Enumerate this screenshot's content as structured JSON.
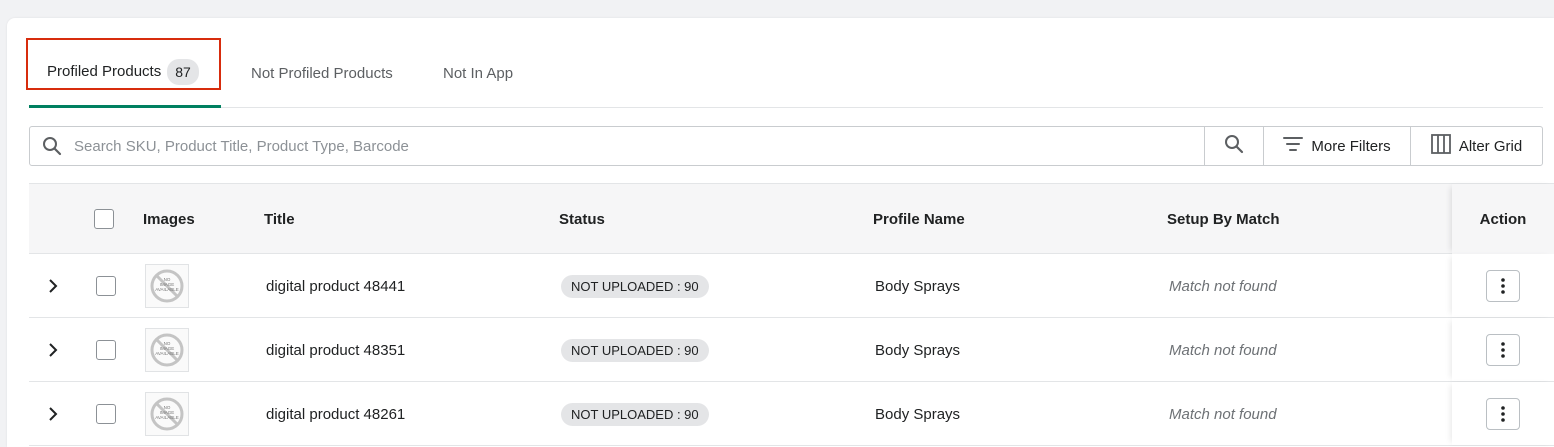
{
  "tabs": [
    {
      "label": "Profiled Products",
      "count": "87",
      "active": true
    },
    {
      "label": "Not Profiled Products"
    },
    {
      "label": "Not In App"
    }
  ],
  "search": {
    "placeholder": "Search SKU, Product Title, Product Type, Barcode",
    "value": ""
  },
  "toolbar": {
    "more_filters": "More Filters",
    "alter_grid": "Alter Grid"
  },
  "table": {
    "headers": {
      "images": "Images",
      "title": "Title",
      "status": "Status",
      "profile": "Profile Name",
      "setup": "Setup By Match",
      "action": "Action"
    },
    "rows": [
      {
        "title": "digital product 48441",
        "status": "NOT UPLOADED : 90",
        "profile": "Body Sprays",
        "setup": "Match not found"
      },
      {
        "title": "digital product 48351",
        "status": "NOT UPLOADED : 90",
        "profile": "Body Sprays",
        "setup": "Match not found"
      },
      {
        "title": "digital product 48261",
        "status": "NOT UPLOADED : 90",
        "profile": "Body Sprays",
        "setup": "Match not found"
      }
    ]
  },
  "thumbnail_text": [
    "NO",
    "IMAGE",
    "AVAILABLE"
  ],
  "colors": {
    "active_tab_underline": "#008060",
    "highlight_box": "#d72c0d"
  }
}
